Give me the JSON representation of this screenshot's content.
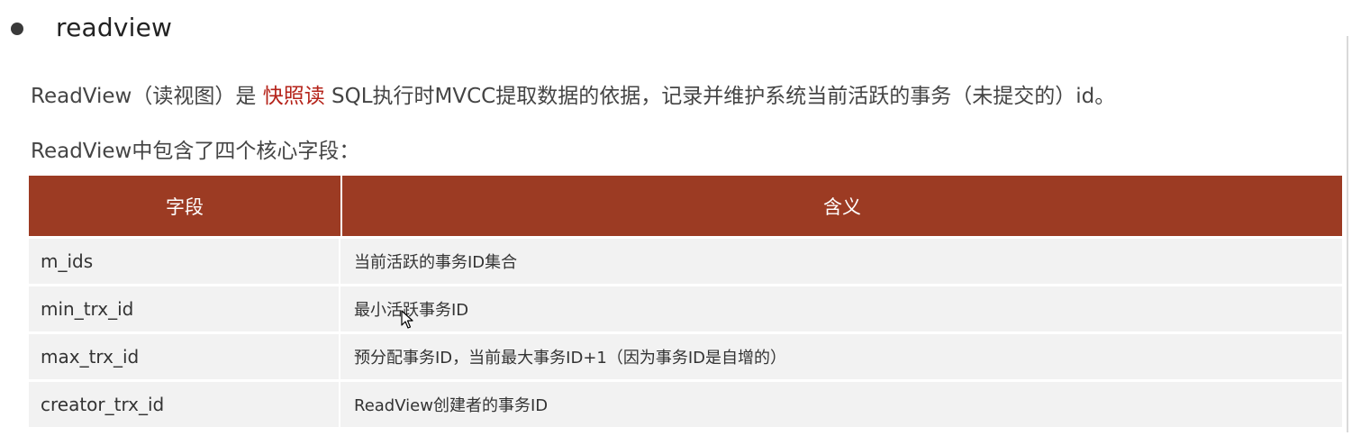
{
  "heading": "readview",
  "paragraph": {
    "before": "ReadView（读视图）是 ",
    "highlight": "快照读",
    "after": " SQL执行时MVCC提取数据的依据，记录并维护系统当前活跃的事务（未提交的）id。"
  },
  "subtitle": "ReadView中包含了四个核心字段：",
  "table": {
    "headers": [
      "字段",
      "含义"
    ],
    "rows": [
      {
        "field": "m_ids",
        "meaning": "当前活跃的事务ID集合"
      },
      {
        "field": "min_trx_id",
        "meaning": "最小活跃事务ID"
      },
      {
        "field": "max_trx_id",
        "meaning": "预分配事务ID，当前最大事务ID+1（因为事务ID是自增的）"
      },
      {
        "field": "creator_trx_id",
        "meaning": "ReadView创建者的事务ID"
      }
    ]
  },
  "colors": {
    "header_bg": "#9c3b23",
    "highlight": "#b5231a",
    "row_bg": "#f2f2f2"
  }
}
